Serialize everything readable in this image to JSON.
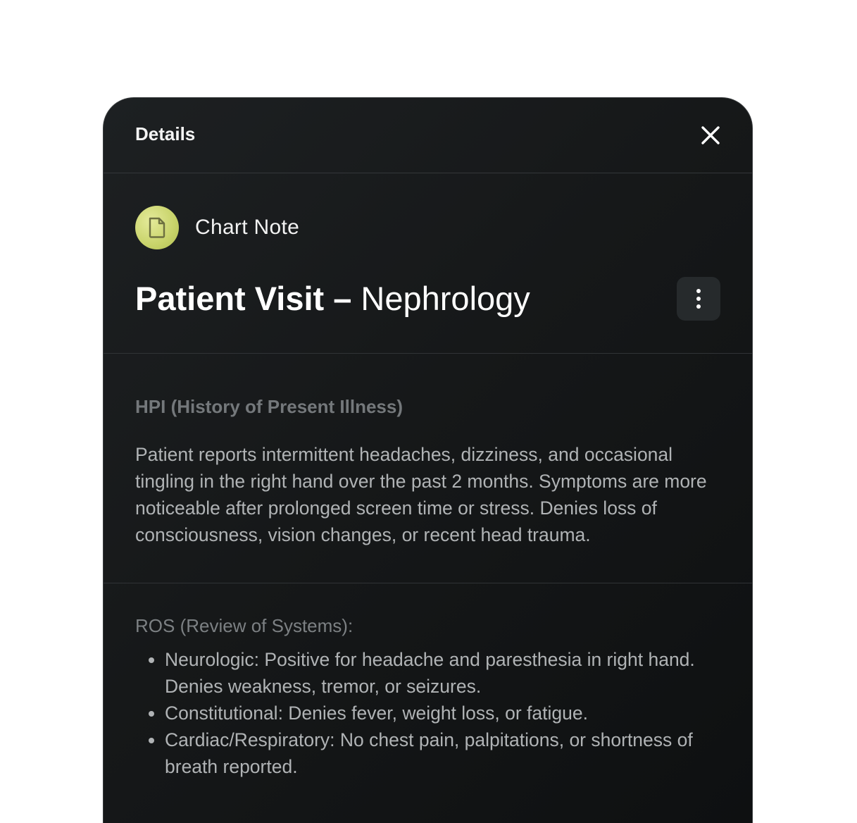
{
  "header": {
    "title": "Details",
    "close_icon": "close-icon"
  },
  "record": {
    "type_icon": "document-icon",
    "type_label": "Chart Note",
    "title_strong": "Patient Visit –",
    "title_light": "Nephrology",
    "more_icon": "more-vertical-icon"
  },
  "hpi": {
    "heading": "HPI (History of Present Illness)",
    "body": "Patient reports intermittent headaches, dizziness, and occasional tingling in the right hand over the past 2 months. Symptoms are more noticeable after prolonged screen time or stress. Denies loss of consciousness, vision changes, or recent head trauma."
  },
  "ros": {
    "heading": "ROS (Review of Systems):",
    "items": [
      "Neurologic: Positive for headache and paresthesia in right hand. Denies weakness, tremor, or seizures.",
      "Constitutional: Denies fever, weight loss, or fatigue.",
      "Cardiac/Respiratory: No chest pain, palpitations, or shortness of breath reported."
    ]
  },
  "colors": {
    "panel_bg": "#17191a",
    "icon_accent": "#d4dd7c",
    "muted_heading": "#74787b",
    "body_text": "#b0b3b5"
  }
}
